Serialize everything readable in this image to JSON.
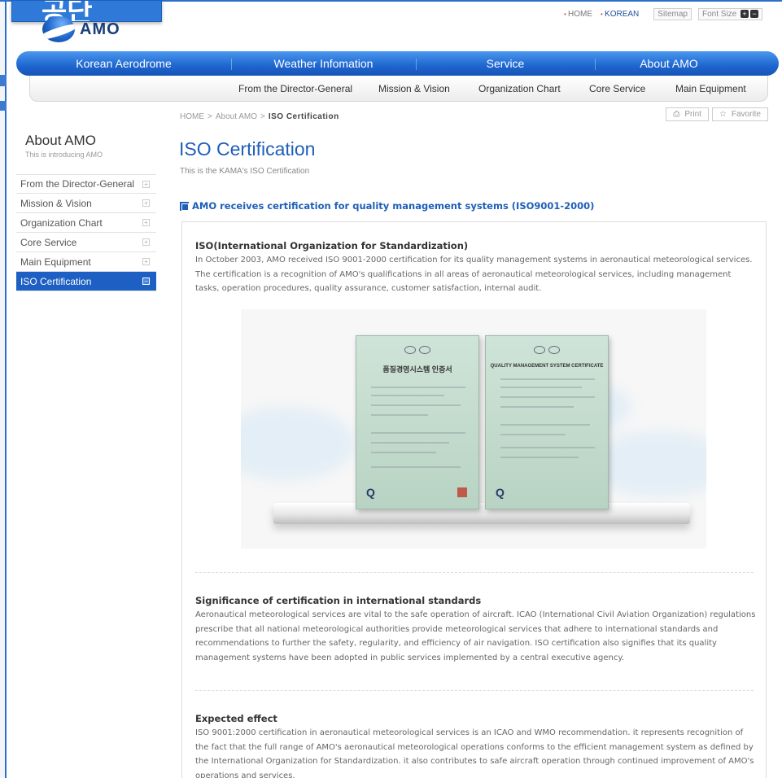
{
  "overlay": {
    "text": "공단"
  },
  "logo": {
    "text": "AMO"
  },
  "utility": {
    "home": "HOME",
    "korean": "KOREAN",
    "sitemap": "Sitemap",
    "font_size": "Font Size",
    "font_plus": "+",
    "font_minus": "−"
  },
  "main_nav": [
    "Korean Aerodrome",
    "Weather Infomation",
    "Service",
    "About AMO"
  ],
  "sub_nav": [
    "From the Director-General",
    "Mission & Vision",
    "Organization Chart",
    "Core Service",
    "Main Equipment"
  ],
  "breadcrumb": {
    "home": "HOME",
    "sep": ">",
    "section": "About AMO",
    "current": "ISO Certification"
  },
  "tools": {
    "print": "Print",
    "favorite": "Favorite"
  },
  "sidebar": {
    "title": "About AMO",
    "subtitle": "This is introducing AMO",
    "items": [
      {
        "label": "From the Director-General",
        "active": false
      },
      {
        "label": "Mission & Vision",
        "active": false
      },
      {
        "label": "Organization Chart",
        "active": false
      },
      {
        "label": "Core Service",
        "active": false
      },
      {
        "label": "Main Equipment",
        "active": false
      },
      {
        "label": "ISO Certification",
        "active": true
      }
    ]
  },
  "page": {
    "title": "ISO Certification",
    "subtitle": "This is the KAMA's ISO Certification",
    "section_heading": "AMO receives certification for quality management systems (ISO9001-2000)"
  },
  "content": {
    "iso_title": "ISO(International Organization for Standardization)",
    "iso_body": "In October 2003, AMO received ISO 9001-2000 certification for its quality management systems in aeronautical meteorological services. The certification is a recognition of AMO's qualifications in all areas of aeronautical meteorological services, including management tasks, operation procedures, quality assurance, customer satisfaction, internal audit.",
    "significance_title": "Significance of certification in international standards",
    "significance_body": "Aeronautical meteorological services are vital to the safe operation of aircraft. ICAO (International Civil Aviation Organization) regulations prescribe that all national meteorological authorities provide meteorological services that adhere to international standards and recommendations to further the safety, regularity, and efficiency of air navigation. ISO certification also signifies that its quality management systems have been adopted in public services implemented by a central executive agency.",
    "effect_title": "Expected effect",
    "effect_body": "ISO 9001:2000 certification in aeronautical meteorological services is an ICAO and WMO recommendation. it represents recognition of the fact that the full range of AMO's aeronautical meteorological operations conforms to the efficient management system as defined by the International Organization for Standardization. it also contributes to safe aircraft operation through continued improvement of AMO's operations and services."
  },
  "certificates": {
    "korean_title": "품질경영시스템 인증서",
    "english_title": "QUALITY MANAGEMENT SYSTEM CERTIFICATE"
  },
  "colors": {
    "brand_blue": "#1e5fb8",
    "nav_blue": "#2a6fc9"
  }
}
